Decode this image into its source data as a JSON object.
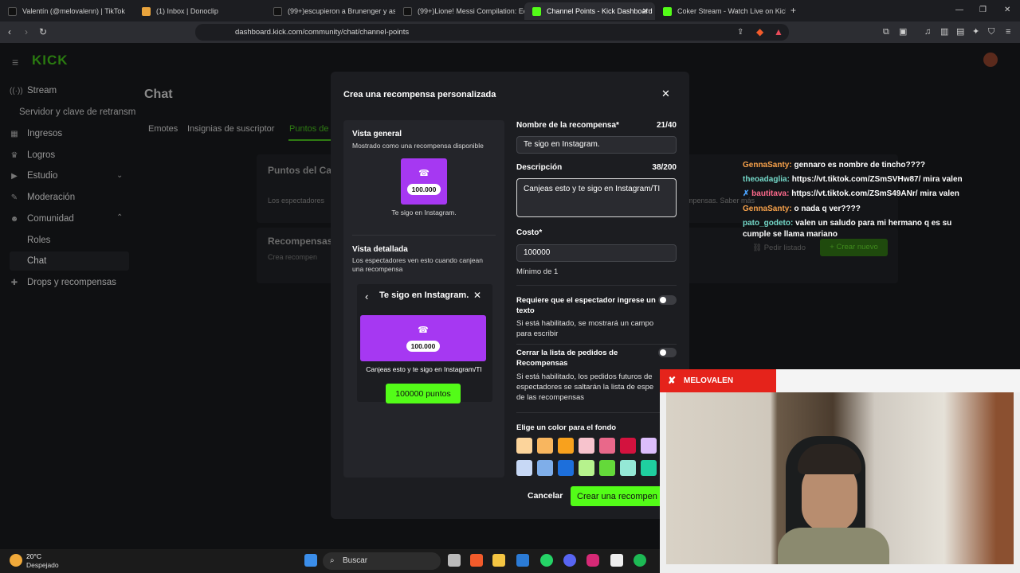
{
  "browser": {
    "tabs": [
      {
        "title": "Valentín (@melovalenn) | TikTok",
        "color": "#111"
      },
      {
        "title": "(1) Inbox | Donoclip",
        "color": "#e8a33c"
      },
      {
        "title": "(99+)escupieron a Brunenger y así s",
        "color": "#111"
      },
      {
        "title": "(99+)Lione! Messi Compilation: Editi",
        "color": "#111"
      },
      {
        "title": "Channel Points - Kick Dashboard",
        "color": "#53fc18"
      },
      {
        "title": "Coker Stream - Watch Live on Kick",
        "color": "#53fc18"
      }
    ],
    "url": "dashboard.kick.com/community/chat/channel-points"
  },
  "sidebar": {
    "items": [
      {
        "label": "Stream",
        "icon": "signal-icon"
      },
      {
        "label": "Servidor y clave de retransm",
        "icon": ""
      },
      {
        "label": "Ingresos",
        "icon": "grid-icon"
      },
      {
        "label": "Logros",
        "icon": "trophy-icon"
      },
      {
        "label": "Estudio",
        "icon": "video-icon"
      },
      {
        "label": "Moderación",
        "icon": "wrench-icon"
      },
      {
        "label": "Comunidad",
        "icon": "people-icon"
      },
      {
        "label": "Roles",
        "icon": ""
      },
      {
        "label": "Chat",
        "icon": ""
      },
      {
        "label": "Drops y recompensas",
        "icon": "gift-icon"
      }
    ]
  },
  "page": {
    "title": "Chat",
    "tabs": [
      "Emotes",
      "Insignias de suscriptor",
      "Puntos de"
    ],
    "section1": "Puntos del Ca",
    "section1_desc": "Los espectadores",
    "section1_desc_right": "mpensas. Saber más",
    "section2": "Recompensas",
    "section2_desc": "Crea recompen",
    "pedir_listado": "Pedir listado",
    "crear_nuevo": "Crear nuevo"
  },
  "modal": {
    "title": "Crea una recompensa personalizada",
    "overview_title": "Vista general",
    "overview_sub": "Mostrado como una recompensa disponible",
    "tile_cost": "100.000",
    "tile_name": "Te sigo en Instagram.",
    "detailed_title": "Vista detallada",
    "detailed_sub": "Los espectadores ven esto cuando canjean una recompensa",
    "detail_header": "Te sigo en Instagram.",
    "detail_desc": "Canjeas esto y te sigo en Instagram/TI",
    "points_button": "100000 puntos",
    "name_label": "Nombre de la recompensa*",
    "name_count": "21/40",
    "name_value": "Te sigo en Instagram.",
    "desc_label": "Descripción",
    "desc_count": "38/200",
    "desc_value": "Canjeas esto y te sigo en Instagram/TI",
    "cost_label": "Costo*",
    "cost_value": "100000",
    "cost_min": "Mínimo de 1",
    "req_text_label": "Requiere que el espectador ingrese un texto",
    "req_text_desc": "Si está habilitado, se mostrará un campo para escribir",
    "close_list_label": "Cerrar la lista de pedidos de Recompensas",
    "close_list_desc": "Si está habilitado, los pedidos futuros de espectadores se saltarán la lista de espe de las recompensas",
    "color_label": "Elige un color para el fondo",
    "swatches_row1": [
      "#fcd49b",
      "#f8b65f",
      "#f8a11d",
      "#f7c3cd",
      "#e9688a",
      "#d3123e",
      "#dcbdfc"
    ],
    "swatches_row2": [
      "#c7d8f5",
      "#7faee9",
      "#1d6fdb",
      "#b6f28d",
      "#64d93a",
      "#94e8d6",
      "#1fcfa0"
    ],
    "cancel": "Cancelar",
    "create": "Crear una recompen"
  },
  "chat": [
    {
      "user": "GennaSanty:",
      "color": "#f7a14a",
      "msg": "gennaro es nombre de tincho????"
    },
    {
      "user": "theoadaglia:",
      "color": "#74d9c9",
      "msg": "https://vt.tiktok.com/ZSmSVHw87/ mira valen"
    },
    {
      "user": "bautitava:",
      "color": "#ff6a8c",
      "msg": "https://vt.tiktok.com/ZSmS49ANr/ mira valen"
    },
    {
      "user": "GennaSanty:",
      "color": "#f7a14a",
      "msg": "o nada q ver????"
    },
    {
      "user": "pato_godeto:",
      "color": "#74d9c9",
      "msg": "valen un saludo para mi hermano q es su cumple se llama mariano"
    }
  ],
  "overlay": {
    "streamer": "MELOVALEN"
  },
  "taskbar": {
    "temp": "20°C",
    "weather": "Despejado",
    "search": "Buscar"
  }
}
